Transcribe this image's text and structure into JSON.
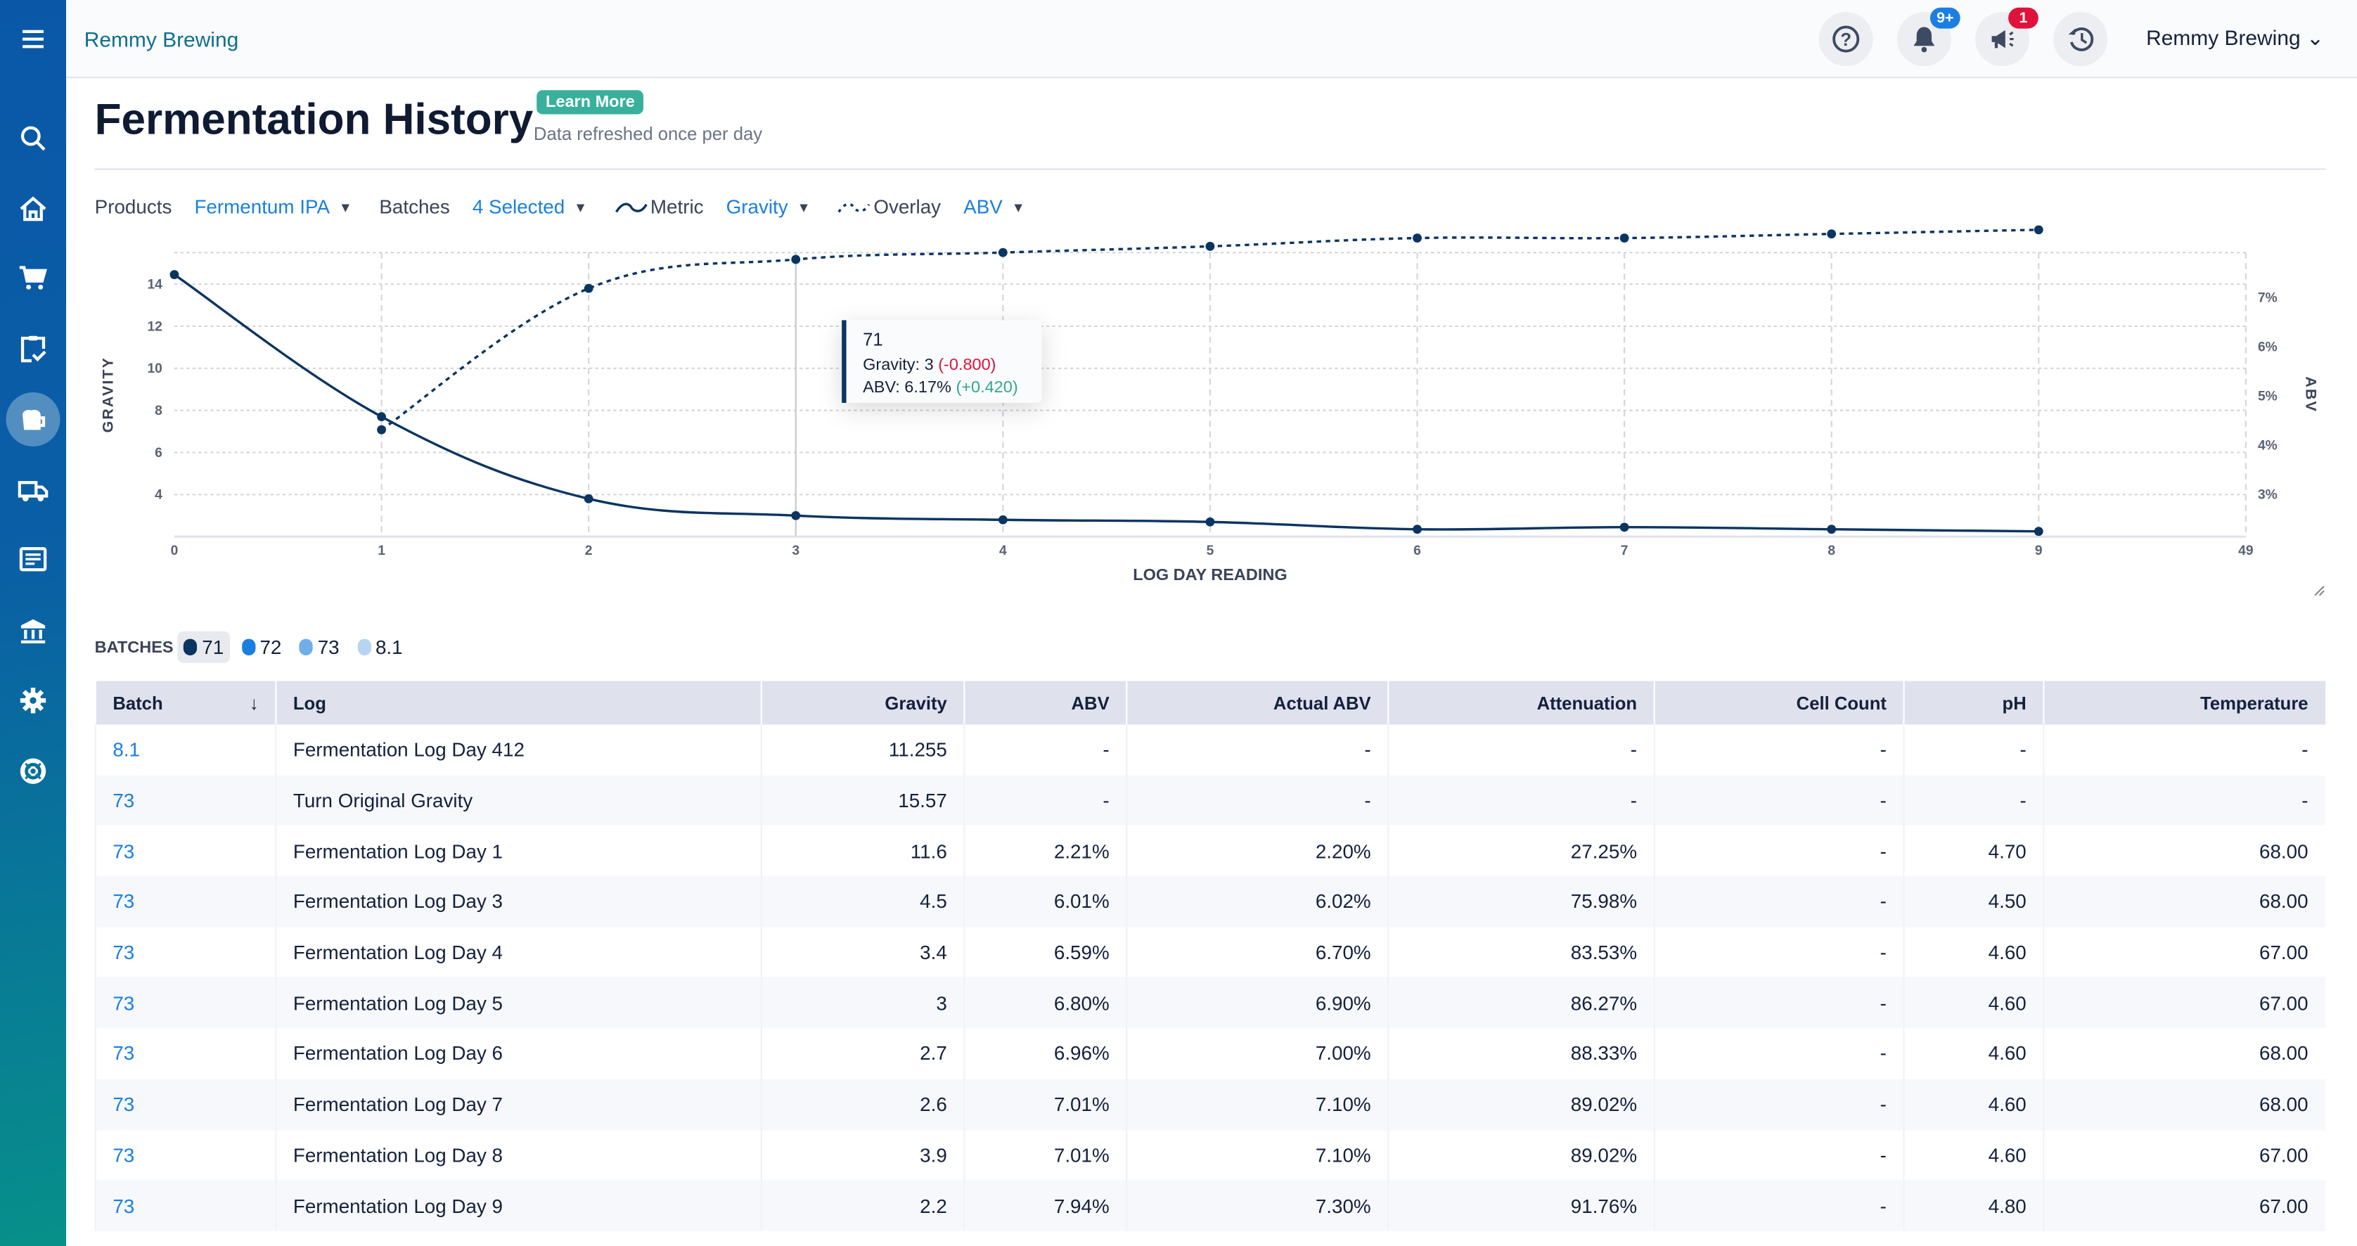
{
  "header": {
    "brand": "Remmy Brewing",
    "account": "Remmy Brewing",
    "notifications_badge": "9+",
    "announcements_badge": "1",
    "badge_colors": {
      "notifications": "#1a7fe0",
      "announcements": "#e0123c"
    }
  },
  "sidebar": {
    "items": [
      "menu-icon",
      "search-icon",
      "home-icon",
      "cart-icon",
      "clipboard-check-icon",
      "beer-mug-icon",
      "truck-icon",
      "document-icon",
      "bank-icon",
      "gear-icon",
      "lifebuoy-icon"
    ],
    "active": "beer-mug-icon"
  },
  "page": {
    "title": "Fermentation History",
    "learn_more": "Learn More",
    "subtitle": "Data refreshed once per day"
  },
  "filters": {
    "products_label": "Products",
    "products_value": "Fermentum IPA",
    "batches_label": "Batches",
    "batches_value": "4 Selected",
    "metric_label": "Metric",
    "metric_value": "Gravity",
    "overlay_label": "Overlay",
    "overlay_value": "ABV"
  },
  "chart_data": {
    "type": "line",
    "xlabel": "LOG DAY READING",
    "ylabel": "GRAVITY",
    "y2label": "ABV",
    "categories": [
      "0",
      "1",
      "2",
      "3",
      "4",
      "5",
      "6",
      "7",
      "8",
      "9",
      "49"
    ],
    "y_ticks": [
      "4",
      "6",
      "8",
      "10",
      "12",
      "14"
    ],
    "y2_ticks": [
      "3%",
      "4%",
      "5%",
      "6%",
      "7%"
    ],
    "ylim": [
      2,
      15.5
    ],
    "y2lim": [
      2.15,
      6.27
    ],
    "grid": true,
    "series": [
      {
        "name": "Gravity",
        "axis": "left",
        "style": "solid",
        "color": "#0b3561",
        "values": [
          14.45,
          7.7,
          3.8,
          3.0,
          2.8,
          2.7,
          2.35,
          2.45,
          2.35,
          2.25
        ]
      },
      {
        "name": "ABV",
        "axis": "right",
        "style": "dashed",
        "color": "#0b3561",
        "x_start": 1,
        "values": [
          3.7,
          5.75,
          6.17,
          6.27,
          6.36,
          6.48,
          6.48,
          6.54,
          6.6
        ]
      }
    ],
    "tooltip": {
      "title": "71",
      "gravity_label": "Gravity: 3",
      "gravity_delta": "(-0.800)",
      "abv_label": "ABV: 6.17%",
      "abv_delta": "(+0.420)",
      "hover_category": "3"
    }
  },
  "batches_legend": {
    "label": "BATCHES",
    "items": [
      {
        "name": "71",
        "color": "#0b3561",
        "selected": true
      },
      {
        "name": "72",
        "color": "#1a7fe0"
      },
      {
        "name": "73",
        "color": "#6faee8"
      },
      {
        "name": "8.1",
        "color": "#b7d5f2"
      }
    ]
  },
  "table": {
    "columns": [
      "Batch",
      "Log",
      "Gravity",
      "ABV",
      "Actual ABV",
      "Attenuation",
      "Cell Count",
      "pH",
      "Temperature"
    ],
    "rows": [
      [
        "8.1",
        "Fermentation Log Day 412",
        "11.255",
        "-",
        "-",
        "-",
        "-",
        "-",
        "-"
      ],
      [
        "73",
        "Turn Original Gravity",
        "15.57",
        "-",
        "-",
        "-",
        "-",
        "-",
        "-"
      ],
      [
        "73",
        "Fermentation Log Day 1",
        "11.6",
        "2.21%",
        "2.20%",
        "27.25%",
        "-",
        "4.70",
        "68.00"
      ],
      [
        "73",
        "Fermentation Log Day 3",
        "4.5",
        "6.01%",
        "6.02%",
        "75.98%",
        "-",
        "4.50",
        "68.00"
      ],
      [
        "73",
        "Fermentation Log Day 4",
        "3.4",
        "6.59%",
        "6.70%",
        "83.53%",
        "-",
        "4.60",
        "67.00"
      ],
      [
        "73",
        "Fermentation Log Day 5",
        "3",
        "6.80%",
        "6.90%",
        "86.27%",
        "-",
        "4.60",
        "67.00"
      ],
      [
        "73",
        "Fermentation Log Day 6",
        "2.7",
        "6.96%",
        "7.00%",
        "88.33%",
        "-",
        "4.60",
        "68.00"
      ],
      [
        "73",
        "Fermentation Log Day 7",
        "2.6",
        "7.01%",
        "7.10%",
        "89.02%",
        "-",
        "4.60",
        "68.00"
      ],
      [
        "73",
        "Fermentation Log Day 8",
        "3.9",
        "7.01%",
        "7.10%",
        "89.02%",
        "-",
        "4.60",
        "67.00"
      ],
      [
        "73",
        "Fermentation Log Day 9",
        "2.2",
        "7.94%",
        "7.30%",
        "91.76%",
        "-",
        "4.80",
        "67.00"
      ]
    ]
  }
}
